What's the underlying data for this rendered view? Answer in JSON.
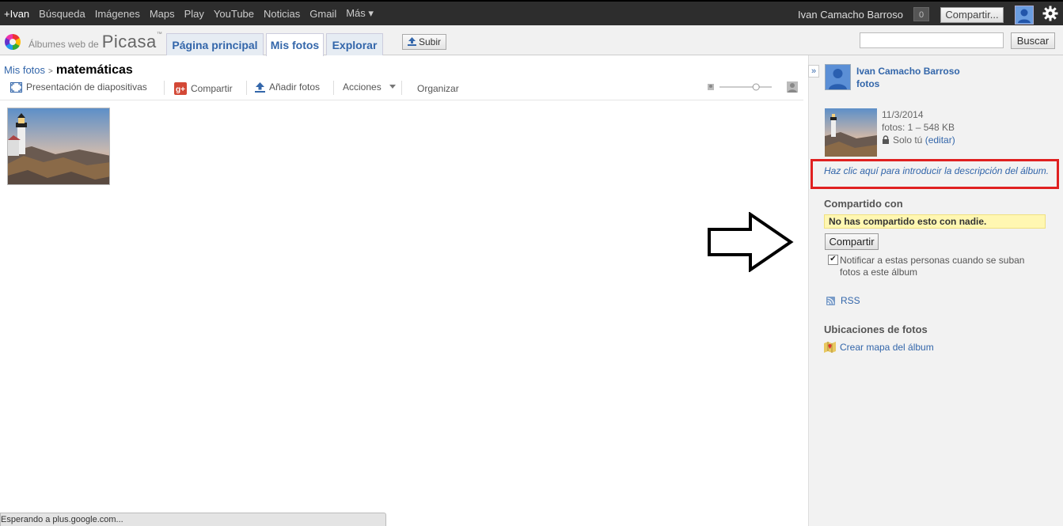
{
  "gbar": {
    "nav": [
      "+Ivan",
      "Búsqueda",
      "Imágenes",
      "Maps",
      "Play",
      "YouTube",
      "Noticias",
      "Gmail",
      "Más ▾"
    ],
    "user_name": "Ivan Camacho Barroso",
    "notification_count": "0",
    "share_label": "Compartir..."
  },
  "header": {
    "logo_small": "Álbumes web de",
    "logo_big": "Picasa",
    "logo_tm": "™",
    "tabs": [
      "Página principal",
      "Mis fotos",
      "Explorar"
    ],
    "active_tab": "Mis fotos",
    "upload_label": "Subir",
    "search_value": "",
    "search_button": "Buscar"
  },
  "breadcrumb": {
    "parent": "Mis fotos",
    "separator": ">",
    "album": "matemáticas"
  },
  "toolbar": {
    "slideshow": "Presentación de diapositivas",
    "share": "Compartir",
    "add_photos": "Añadir fotos",
    "actions": "Acciones",
    "organize": "Organizar",
    "zoom_level": 0.7
  },
  "panel": {
    "owner_name": "Ivan Camacho Barroso",
    "owner_sub": "fotos",
    "date": "11/3/2014",
    "photos_info": "fotos: 1 – 548 KB",
    "privacy": "Solo tú",
    "edit_link": "(editar)",
    "description_prompt": "Haz clic aquí para introducir la descripción del álbum.",
    "shared_heading": "Compartido con",
    "not_shared": "No has compartido esto con nadie.",
    "share_button": "Compartir",
    "notify_text": "Notificar a estas personas cuando se suban fotos a este álbum",
    "notify_checked": true,
    "rss": "RSS",
    "locations_heading": "Ubicaciones de fotos",
    "create_map": "Crear mapa del álbum"
  },
  "status_bar": "Esperando a plus.google.com...",
  "colors": {
    "link": "#3366aa",
    "highlight_box": "#e02020",
    "notice_bg": "#fff7b2",
    "top_bar": "#2d2d2d"
  }
}
